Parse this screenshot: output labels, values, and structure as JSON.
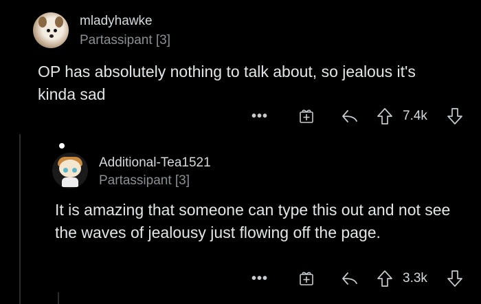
{
  "comments": [
    {
      "username": "mladyhawke",
      "flair": "Partassipant [3]",
      "body": "OP has absolutely nothing to talk about, so jealous it's kinda sad",
      "more_label": "•••",
      "score": "7.4k",
      "avatar_icon": "dog-avatar-icon"
    },
    {
      "username": "Additional-Tea1521",
      "flair": "Partassipant [3]",
      "body": "It is amazing that someone can type this out and not  see the waves of jealousy just flowing off the page.",
      "more_label": "•••",
      "score": "3.3k",
      "avatar_icon": "snoo-avatar-icon"
    }
  ],
  "colors": {
    "background": "#000000",
    "text": "#e3e5e6",
    "muted": "#8b8f92",
    "thread_line": "#2c2c2c"
  }
}
